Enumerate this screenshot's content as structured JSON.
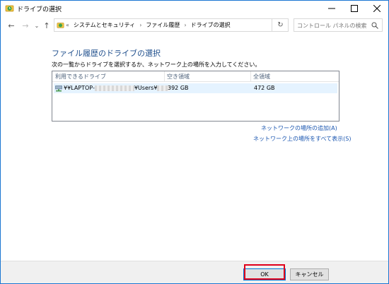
{
  "window": {
    "title": "ドライブの選択",
    "caption": {
      "minimize": "—",
      "maximize": "☐",
      "close": "✕"
    }
  },
  "nav": {
    "back": "←",
    "forward": "→",
    "recent": "⌄",
    "up": "↑",
    "breadcrumb": {
      "overflow": "«",
      "items": [
        "システムとセキュリティ",
        "ファイル履歴",
        "ドライブの選択"
      ],
      "separator": "›"
    },
    "refresh": "↻",
    "search_placeholder": "コントロール パネルの検索"
  },
  "content": {
    "heading": "ファイル履歴のドライブの選択",
    "instruction": "次の一覧からドライブを選択するか、ネットワーク上の場所を入力してください。",
    "table": {
      "columns": [
        "利用できるドライブ",
        "空き領域",
        "全領域"
      ],
      "rows": [
        {
          "drive_prefix": "¥¥LAPTOP-",
          "drive_mid": "¥Users¥",
          "free": "392 GB",
          "total": "472 GB"
        }
      ]
    },
    "links": {
      "add_network": "ネットワークの場所の追加(A)",
      "show_all_network": "ネットワーク上の場所をすべて表示(S)"
    }
  },
  "footer": {
    "ok": "OK",
    "cancel": "キャンセル"
  },
  "colors": {
    "heading": "#1e4e8c",
    "link": "#1a56b0",
    "highlight": "#e0001b",
    "selected_row": "#e5f3ff"
  }
}
